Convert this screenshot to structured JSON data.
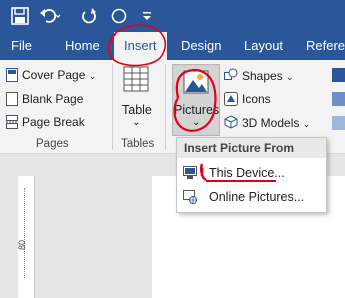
{
  "quick_access": {
    "icons": [
      "save-icon",
      "undo-icon",
      "redo-icon",
      "circle-icon",
      "customize-qat-icon"
    ]
  },
  "tabs": {
    "file": "File",
    "home": "Home",
    "insert": "Insert",
    "design": "Design",
    "layout": "Layout",
    "references": "Referen"
  },
  "ribbon": {
    "pages": {
      "cover_page": "Cover Page",
      "blank_page": "Blank Page",
      "page_break": "Page Break",
      "group_label": "Pages"
    },
    "tables": {
      "table": "Table",
      "group_label": "Tables"
    },
    "illustrations": {
      "pictures": "Pictures",
      "shapes": "Shapes",
      "icons": "Icons",
      "models_3d": "3D Models"
    }
  },
  "dropdown": {
    "header": "Insert Picture From",
    "items": [
      {
        "label": "This Device...",
        "icon": "device-icon"
      },
      {
        "label": "Online Pictures...",
        "icon": "online-pictures-icon"
      }
    ]
  },
  "ruler": {
    "number": "80"
  },
  "colors": {
    "accent": "#2b579a",
    "annotation": "#e3001b"
  }
}
